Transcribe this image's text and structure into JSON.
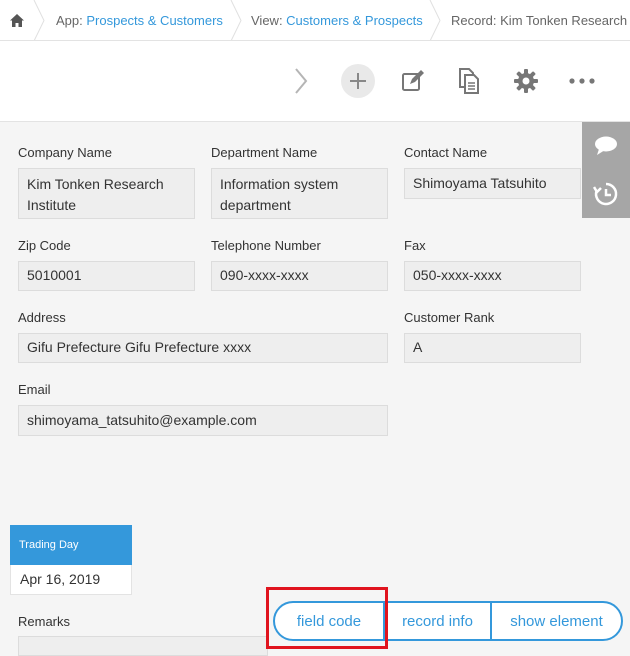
{
  "breadcrumb": {
    "app_prefix": "App: ",
    "app_name": "Prospects & Customers",
    "view_prefix": "View: ",
    "view_name": "Customers & Prospects",
    "record": "Record: Kim Tonken Research Institute"
  },
  "toolbar": {
    "icons": [
      "chevron-right-icon",
      "add-icon",
      "edit-icon",
      "duplicate-icon",
      "gear-icon",
      "more-icon"
    ]
  },
  "side_tabs": [
    "comment-icon",
    "history-icon"
  ],
  "fields": {
    "company_name": {
      "label": "Company Name",
      "value": "Kim Tonken Research Institute"
    },
    "department_name": {
      "label": "Department Name",
      "value": "Information system department"
    },
    "contact_name": {
      "label": "Contact Name",
      "value": "Shimoyama Tatsuhito"
    },
    "zip_code": {
      "label": "Zip Code",
      "value": "5010001"
    },
    "telephone": {
      "label": "Telephone Number",
      "value": "090-xxxx-xxxx"
    },
    "fax": {
      "label": "Fax",
      "value": "050-xxxx-xxxx"
    },
    "address": {
      "label": "Address",
      "value": "Gifu Prefecture Gifu Prefecture xxxx"
    },
    "customer_rank": {
      "label": "Customer Rank",
      "value": "A"
    },
    "email": {
      "label": "Email",
      "value": "shimoyama_tatsuhito@example.com"
    },
    "remarks": {
      "label": "Remarks"
    }
  },
  "trading_day": {
    "label": "Trading Day",
    "value": "Apr 16, 2019"
  },
  "pill": {
    "field_code": "field code",
    "record_info": "record info",
    "show_element": "show element"
  },
  "colors": {
    "accent": "#3498db",
    "highlight": "#e0141e"
  }
}
